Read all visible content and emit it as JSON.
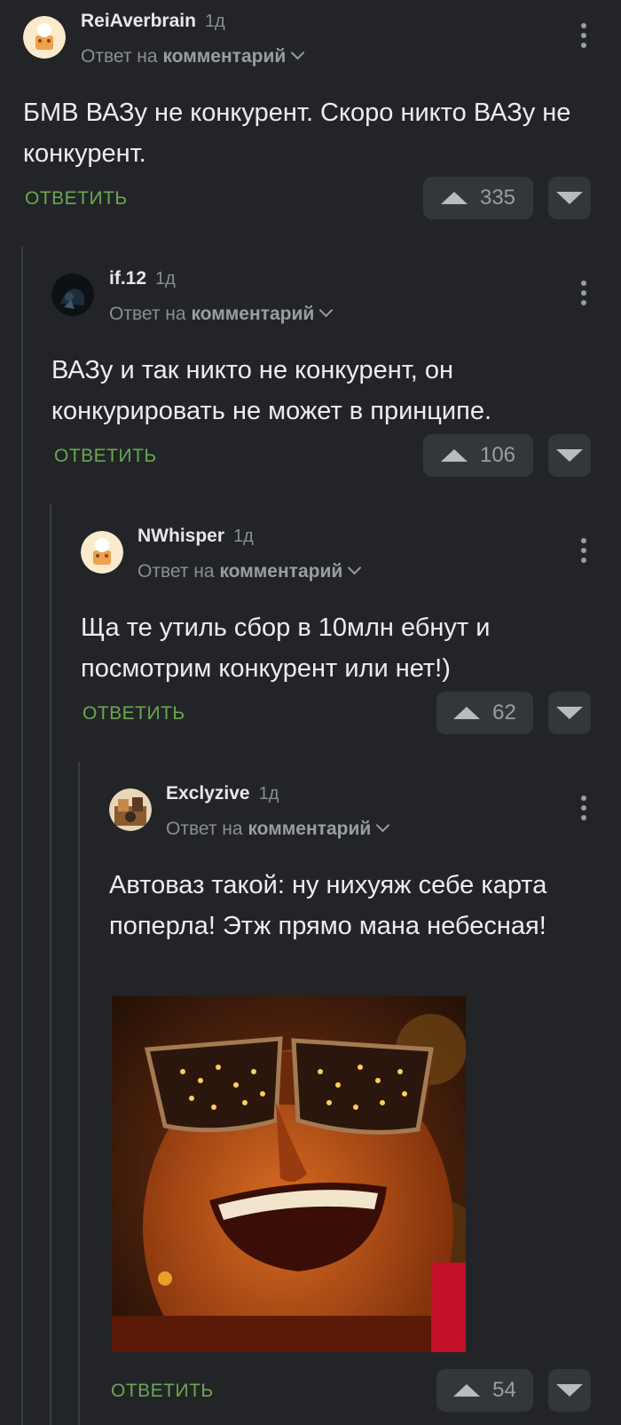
{
  "comments": [
    {
      "author": "ReiAverbrain",
      "age": "1д",
      "reply_prefix": "Ответ на",
      "reply_target": "комментарий",
      "text": "БМВ ВАЗу не конкурент. Скоро никто ВАЗу не конкурент.",
      "reply_label": "ОТВЕТИТЬ",
      "score": "335"
    },
    {
      "author": "if.12",
      "age": "1д",
      "reply_prefix": "Ответ на",
      "reply_target": "комментарий",
      "text": "ВАЗу и так никто не конкурент, он конкурировать не может в принципе.",
      "reply_label": "ОТВЕТИТЬ",
      "score": "106"
    },
    {
      "author": "NWhisper",
      "age": "1д",
      "reply_prefix": "Ответ на",
      "reply_target": "комментарий",
      "text": "Ща те утиль сбор в 10млн ебнут и посмотрим конкурент или нет!)",
      "reply_label": "ОТВЕТИТЬ",
      "score": "62"
    },
    {
      "author": "Exclyzive",
      "age": "1д",
      "reply_prefix": "Ответ на",
      "reply_target": "комментарий",
      "text": "Автоваз такой: ну нихуяж себе карта поперла! Этж прямо мана небесная!",
      "reply_label": "ОТВЕТИТЬ",
      "score": "54"
    }
  ],
  "icons": {
    "vote_up": "triangle-up-icon",
    "vote_down": "triangle-down-icon",
    "menu": "kebab-menu-icon",
    "expand": "chevron-down-icon"
  },
  "colors": {
    "background": "#222428",
    "reply_action": "#6aa84f",
    "vote_bg": "#33363b"
  }
}
